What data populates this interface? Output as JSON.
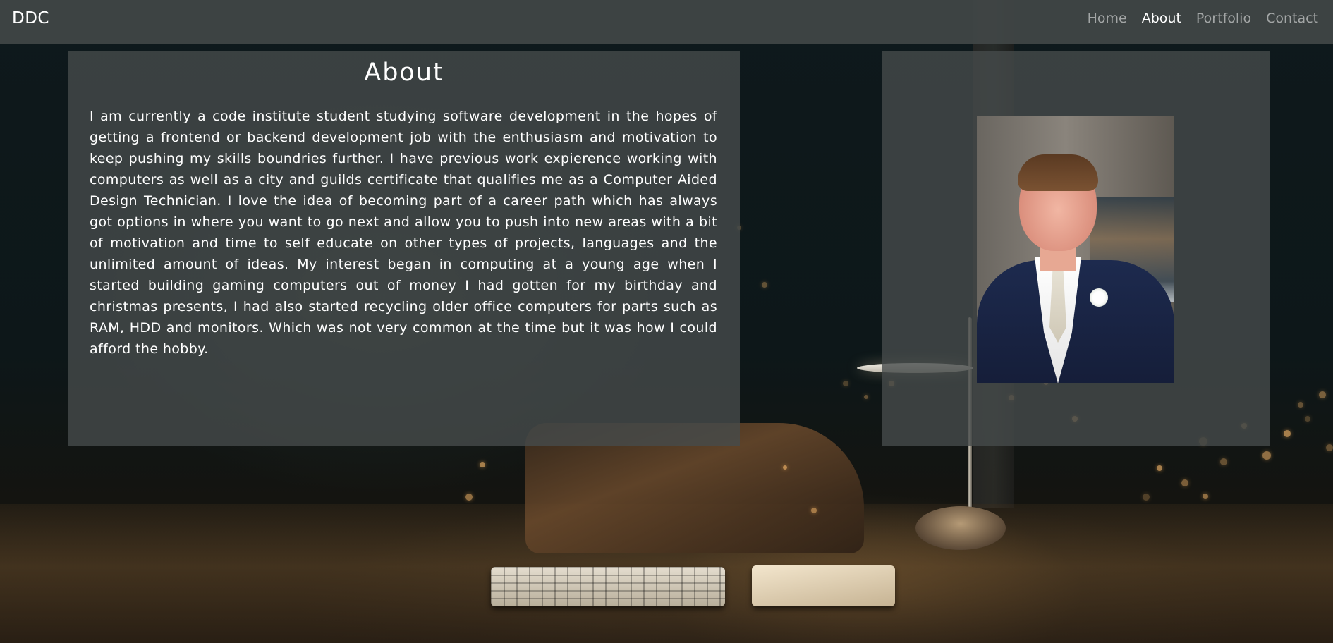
{
  "navbar": {
    "brand": "DDC",
    "links": [
      {
        "label": "Home",
        "active": false
      },
      {
        "label": "About",
        "active": true
      },
      {
        "label": "Portfolio",
        "active": false
      },
      {
        "label": "Contact",
        "active": false
      }
    ]
  },
  "about": {
    "title": "About",
    "body": "I am currently a code institute student studying software development in the hopes of getting a frontend or backend development job with the enthusiasm and motivation to keep pushing my skills boundries further. I have previous work expierence working with computers as well as a city and guilds certificate that qualifies me as a Computer Aided Design Technician. I love the idea of becoming part of a career path which has always got options in where you want to go next and allow you to push into new areas with a bit of motivation and time to self educate on other types of projects, languages and the unlimited amount of ideas. My interest began in computing at a young age when I started building gaming computers out of money I had gotten for my birthday and christmas presents, I had also started recycling older office computers for parts such as RAM, HDD and monitors. Which was not very common at the time but it was how I could afford the hobby."
  },
  "colors": {
    "navbar_bg": "#414646",
    "panel_bg": "#464b4b",
    "nav_inactive": "#a3a6a6",
    "nav_active": "#ffffff",
    "text": "#ffffff"
  },
  "icons": {
    "profile_photo": "portrait-photo"
  }
}
